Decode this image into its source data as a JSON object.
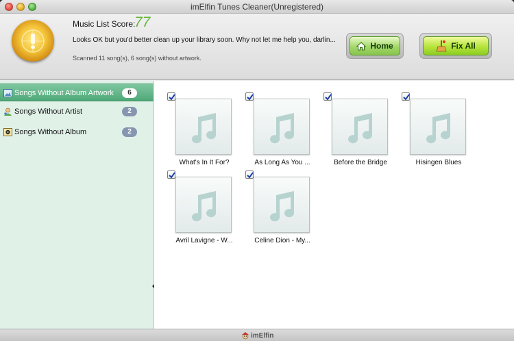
{
  "window": {
    "title": "imElfin Tunes Cleaner(Unregistered)"
  },
  "header": {
    "score_label": "Music List Score:",
    "score_value": "77",
    "status_message": "Looks OK but you'd better clean up your library soon. Why not let me help you, darlin...",
    "scan_info": "Scanned 11 song(s), 6 song(s) without artwork.",
    "home_label": "Home",
    "fix_all_label": "Fix All"
  },
  "sidebar": {
    "items": [
      {
        "label": "Songs Without Album Artwork",
        "count": "6",
        "icon": "artwork-icon"
      },
      {
        "label": "Songs Without Artist",
        "count": "2",
        "icon": "artist-icon"
      },
      {
        "label": "Songs Without Album",
        "count": "2",
        "icon": "album-icon"
      }
    ]
  },
  "songs": [
    {
      "title": "What's In It For?",
      "checked": true
    },
    {
      "title": "As Long As You ...",
      "checked": true
    },
    {
      "title": "Before the Bridge",
      "checked": true
    },
    {
      "title": "Hisingen Blues",
      "checked": true
    },
    {
      "title": "Avril Lavigne - W...",
      "checked": true
    },
    {
      "title": "Celine Dion - My...",
      "checked": true
    }
  ],
  "footer": {
    "brand": "imElfin"
  },
  "colors": {
    "score_green": "#64b53c",
    "sidebar_bg": "#e0f1e8",
    "selected_item": "#4fa878",
    "count_badge": "#8796b0"
  }
}
